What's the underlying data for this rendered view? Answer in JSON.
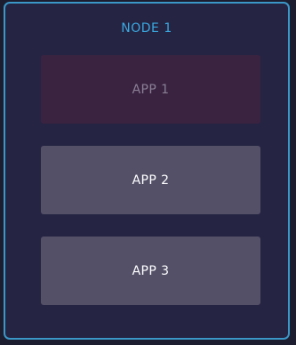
{
  "node": {
    "title": "NODE 1",
    "border_color": "#3a97c8",
    "background_color": "#252442",
    "title_color": "#3aa8e0"
  },
  "apps": [
    {
      "label": "APP 1",
      "state": "dimmed",
      "background_color": "#3a2341",
      "text_color": "#8a7f95"
    },
    {
      "label": "APP 2",
      "state": "normal",
      "background_color": "#545068",
      "text_color": "#ffffff"
    },
    {
      "label": "APP 3",
      "state": "normal",
      "background_color": "#545068",
      "text_color": "#ffffff"
    }
  ]
}
